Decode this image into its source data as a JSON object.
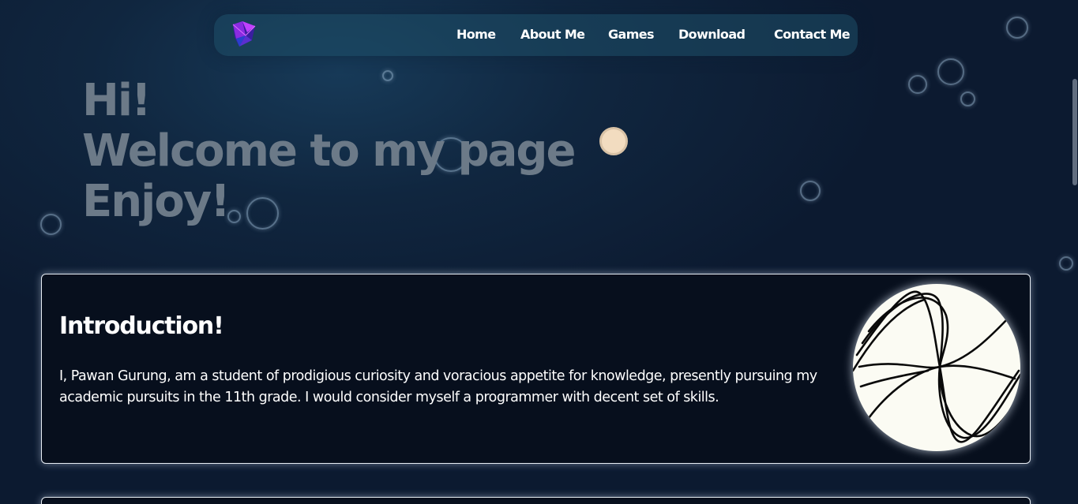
{
  "nav": {
    "logo_icon": "purple-geometric-logo-icon",
    "links": [
      {
        "label": "Home"
      },
      {
        "label": "About Me"
      },
      {
        "label": "Games"
      },
      {
        "label": "Download"
      },
      {
        "label": "Contact Me"
      }
    ]
  },
  "hero": {
    "lines": [
      "Hi!",
      "Welcome to my page",
      "Enjoy!"
    ]
  },
  "intro": {
    "title": "Introduction!",
    "text": "I, Pawan Gurung, am a student of prodigious curiosity and voracious appetite for knowledge, presently pursuing my academic pursuits in the 11th grade. I would consider myself a programmer with decent set of skills.",
    "avatar_icon": "abstract-line-art-avatar"
  },
  "colors": {
    "background": "#0c1a30",
    "nav_background": "#1e4e68",
    "hero_text": "#6c7a88",
    "card_background": "#070f1d",
    "card_border": "#e8eef5",
    "moon": "#f2dcc0",
    "logo_accent": "#8a2be2"
  }
}
